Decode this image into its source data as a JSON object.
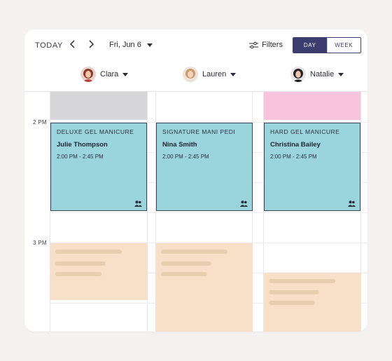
{
  "toolbar": {
    "today_label": "TODAY",
    "date_label": "Fri, Jun 6",
    "filters_label": "Filters",
    "view_day": "DAY",
    "view_week": "WEEK"
  },
  "staff": [
    {
      "name": "Clara"
    },
    {
      "name": "Lauren"
    },
    {
      "name": "Natalie"
    }
  ],
  "time_labels": [
    "2 PM",
    "3 PM"
  ],
  "appointments": [
    {
      "service": "DELUXE GEL MANICURE",
      "client": "Julie Thompson",
      "time": "2:00 PM - 2:45 PM"
    },
    {
      "service": "SIGNATURE MANI PEDI",
      "client": "Nina Smith",
      "time": "2:00 PM - 2:45 PM"
    },
    {
      "service": "HARD GEL MANICURE",
      "client": "Christina Bailey",
      "time": "2:00 PM - 2:45 PM"
    }
  ],
  "colors": {
    "appointment": "#9ad5de",
    "blocked_gray": "#d6d6d8",
    "blocked_pink": "#f7c4dc",
    "placeholder": "#f8e0c8",
    "accent": "#3b3d6e"
  },
  "icons": {
    "prev": "chevron-left-icon",
    "next": "chevron-right-icon",
    "filters": "sliders-icon",
    "group": "group-icon"
  }
}
